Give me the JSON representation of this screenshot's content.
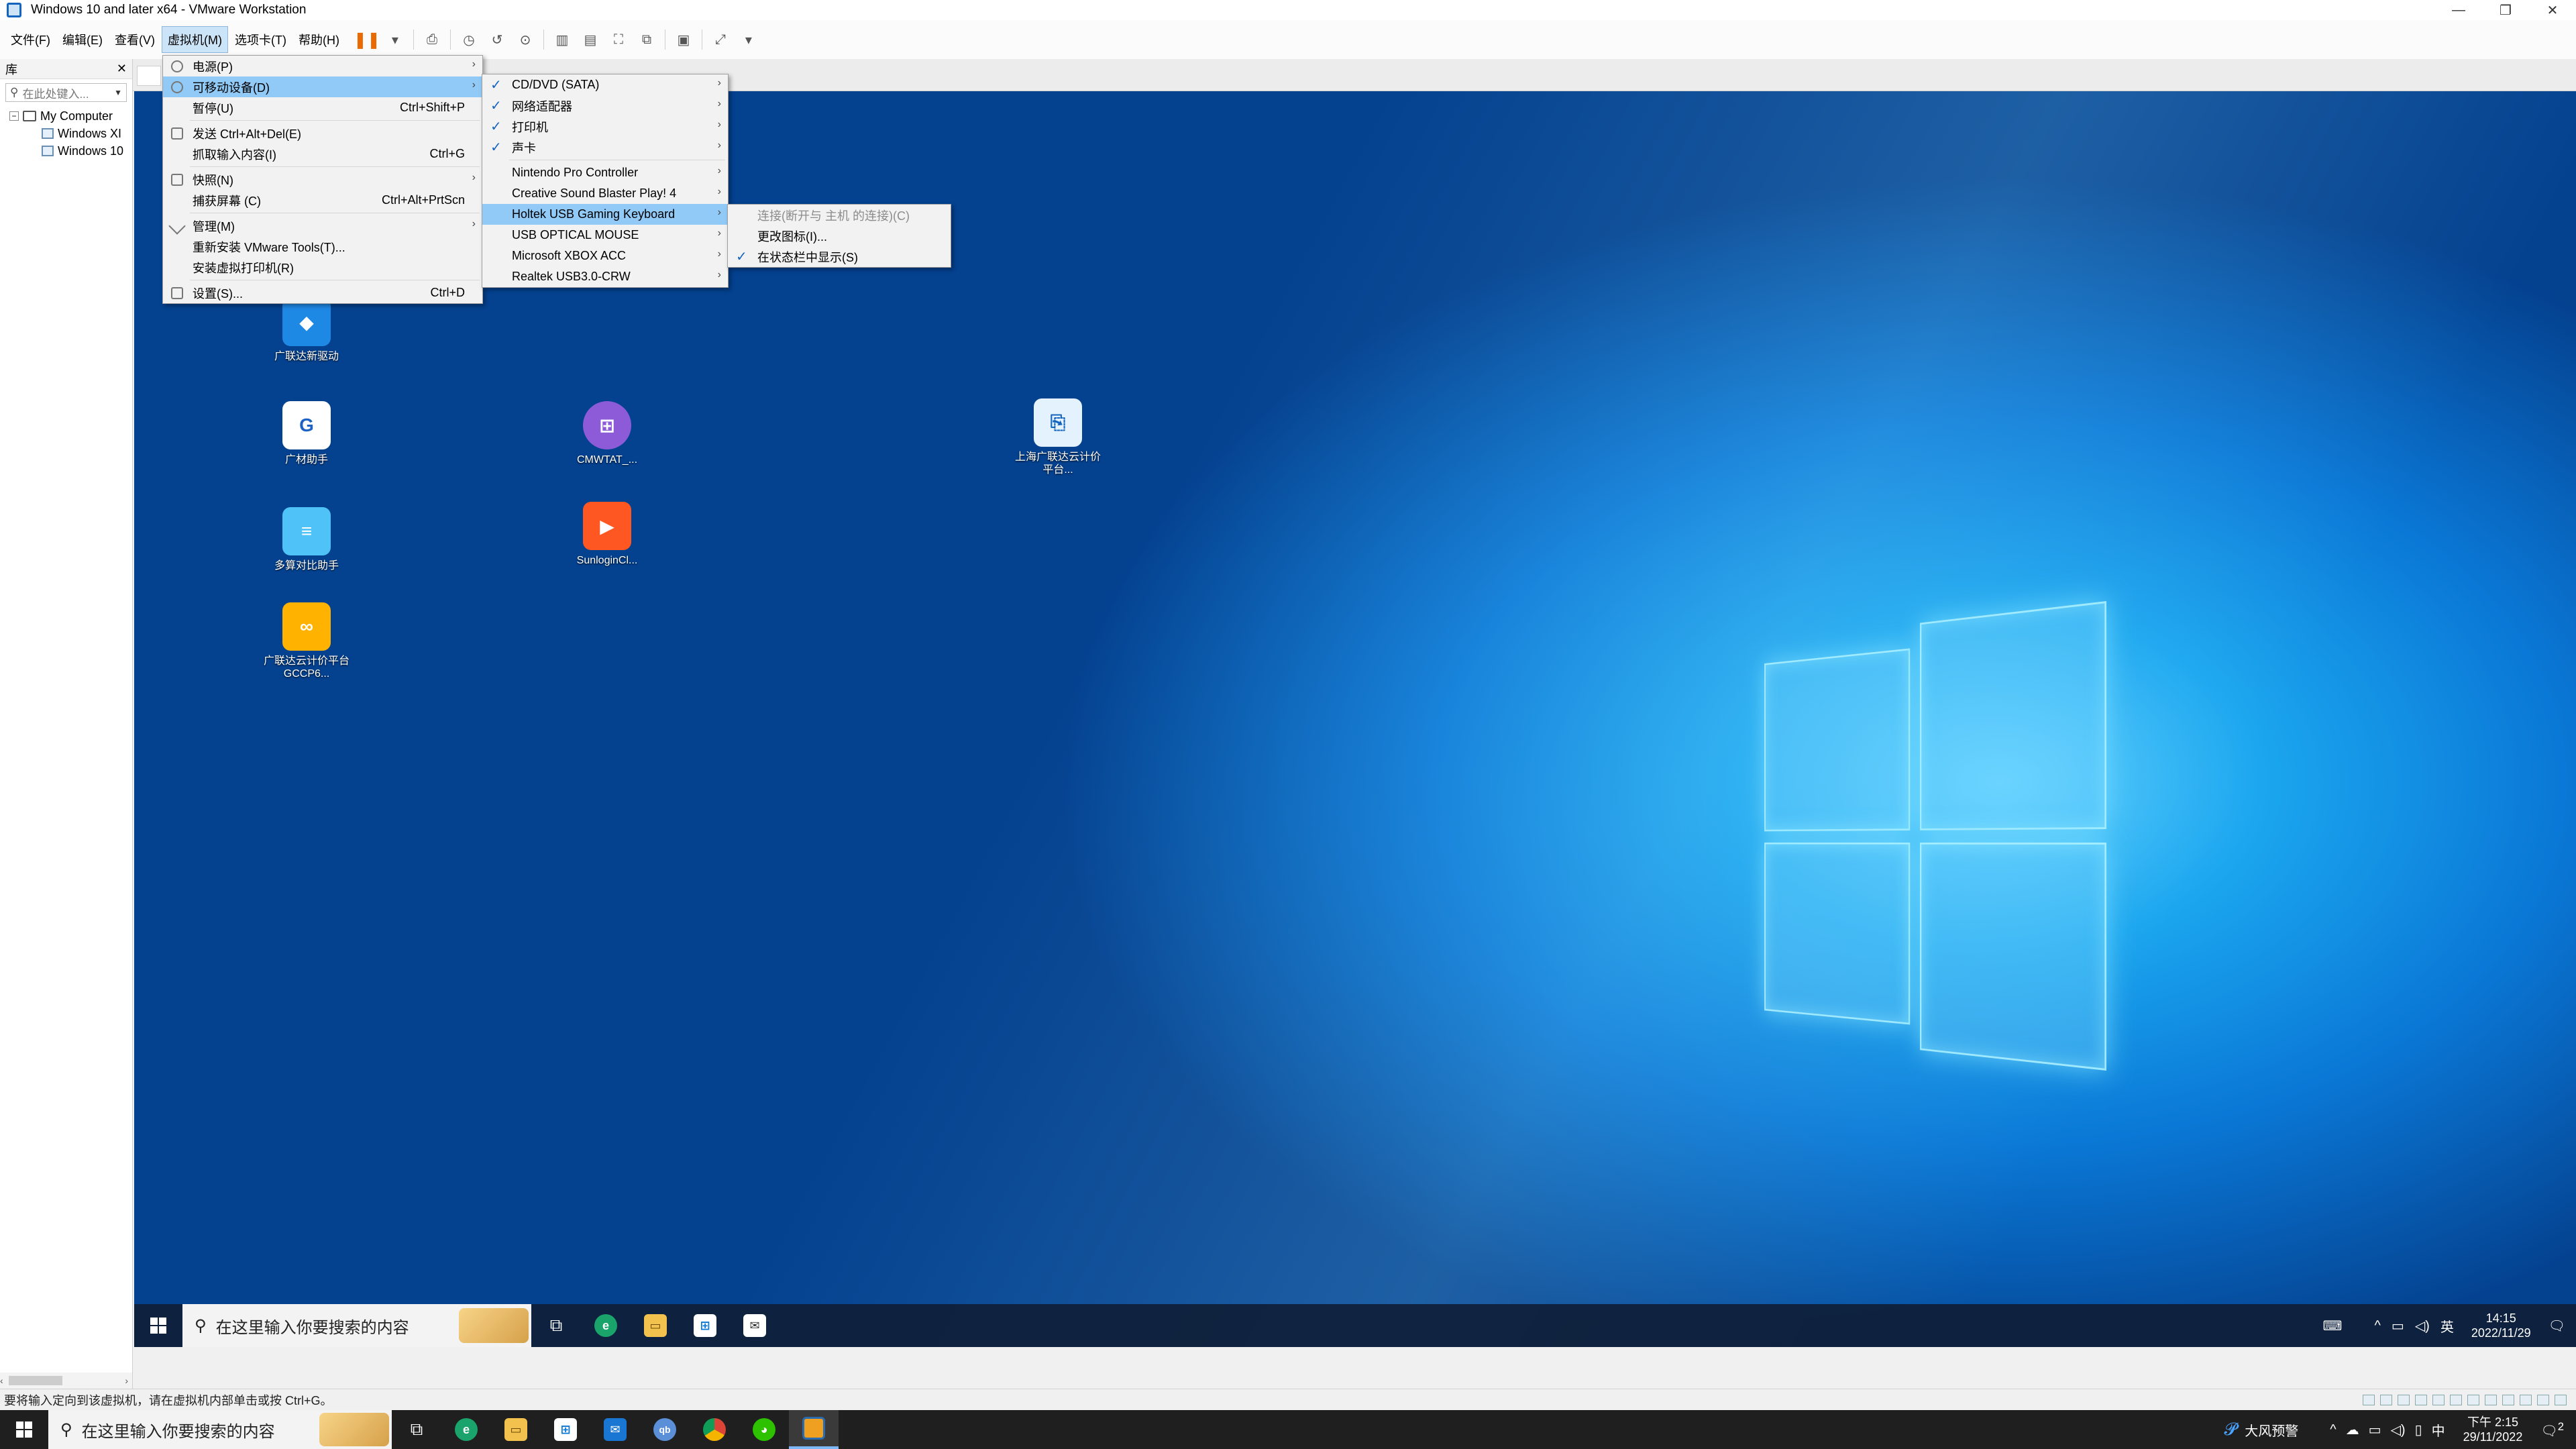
{
  "window": {
    "title": "Windows 10 and later x64 - VMware Workstation",
    "controls": [
      "—",
      "❐",
      "✕"
    ]
  },
  "menubar": {
    "items": [
      "文件(F)",
      "编辑(E)",
      "查看(V)",
      "虚拟机(M)",
      "选项卡(T)",
      "帮助(H)"
    ],
    "active_index": 3
  },
  "library": {
    "title": "库",
    "close": "✕",
    "search_placeholder": "在此处键入...",
    "tree": {
      "root": "My Computer",
      "children": [
        "Windows XI",
        "Windows 10"
      ]
    }
  },
  "vm_menu": {
    "items": [
      {
        "label": "电源(P)",
        "shortcut": "",
        "submenu": true
      },
      {
        "label": "可移动设备(D)",
        "shortcut": "",
        "submenu": true,
        "highlighted": true
      },
      {
        "label": "暂停(U)",
        "shortcut": "Ctrl+Shift+P"
      },
      {
        "label": "发送 Ctrl+Alt+Del(E)",
        "shortcut": ""
      },
      {
        "label": "抓取输入内容(I)",
        "shortcut": "Ctrl+G"
      },
      {
        "label": "快照(N)",
        "shortcut": "",
        "submenu": true
      },
      {
        "label": "捕获屏幕 (C)",
        "shortcut": "Ctrl+Alt+PrtScn"
      },
      {
        "label": "管理(M)",
        "shortcut": "",
        "submenu": true
      },
      {
        "label": "重新安装 VMware Tools(T)...",
        "shortcut": ""
      },
      {
        "label": "安装虚拟打印机(R)",
        "shortcut": ""
      },
      {
        "label": "设置(S)...",
        "shortcut": "Ctrl+D"
      }
    ]
  },
  "devices_menu": {
    "items": [
      {
        "label": "CD/DVD (SATA)",
        "checked": true
      },
      {
        "label": "网络适配器",
        "checked": true
      },
      {
        "label": "打印机",
        "checked": true
      },
      {
        "label": "声卡",
        "checked": true
      },
      {
        "label": "Nintendo Pro Controller",
        "checked": false
      },
      {
        "label": "Creative Sound Blaster Play! 4",
        "checked": false
      },
      {
        "label": "Holtek USB Gaming Keyboard",
        "checked": false,
        "highlighted": true
      },
      {
        "label": "USB OPTICAL MOUSE",
        "checked": false
      },
      {
        "label": "Microsoft XBOX ACC",
        "checked": false
      },
      {
        "label": "Realtek USB3.0-CRW",
        "checked": false
      }
    ]
  },
  "keyboard_menu": {
    "items": [
      {
        "label": "连接(断开与 主机 的连接)(C)",
        "disabled": true,
        "checked": false
      },
      {
        "label": "更改图标(I)...",
        "disabled": false,
        "checked": false
      },
      {
        "label": "在状态栏中显示(S)",
        "disabled": false,
        "checked": true
      }
    ]
  },
  "desktop_icons": [
    {
      "label": "广联达新驱动",
      "color": "#1e88e5"
    },
    {
      "label": "广材助手",
      "color": "#ffffff"
    },
    {
      "label": "CMWTAT_...",
      "color": "#8e5bd8"
    },
    {
      "label": "上海广联达云计价平台...",
      "color": "#e3f2fd"
    },
    {
      "label": "多算对比助手",
      "color": "#4fc3f7"
    },
    {
      "label": "SunloginCl...",
      "color": "#ff5722"
    },
    {
      "label": "广联达云计价平台GCCP6...",
      "color": "#ffb300"
    }
  ],
  "guest_taskbar": {
    "search_placeholder": "在这里输入你要搜索的内容",
    "clock_time": "14:15",
    "clock_date": "2022/11/29",
    "ime": "英"
  },
  "statusbar": {
    "text": "要将输入定向到该虚拟机，请在虚拟机内部单击或按 Ctrl+G。"
  },
  "host_taskbar": {
    "search_placeholder": "在这里输入你要搜索的内容",
    "weather": "大风预警",
    "ime": "中",
    "clock_time": "下午 2:15",
    "clock_date": "29/11/2022",
    "notif_count": "2"
  }
}
